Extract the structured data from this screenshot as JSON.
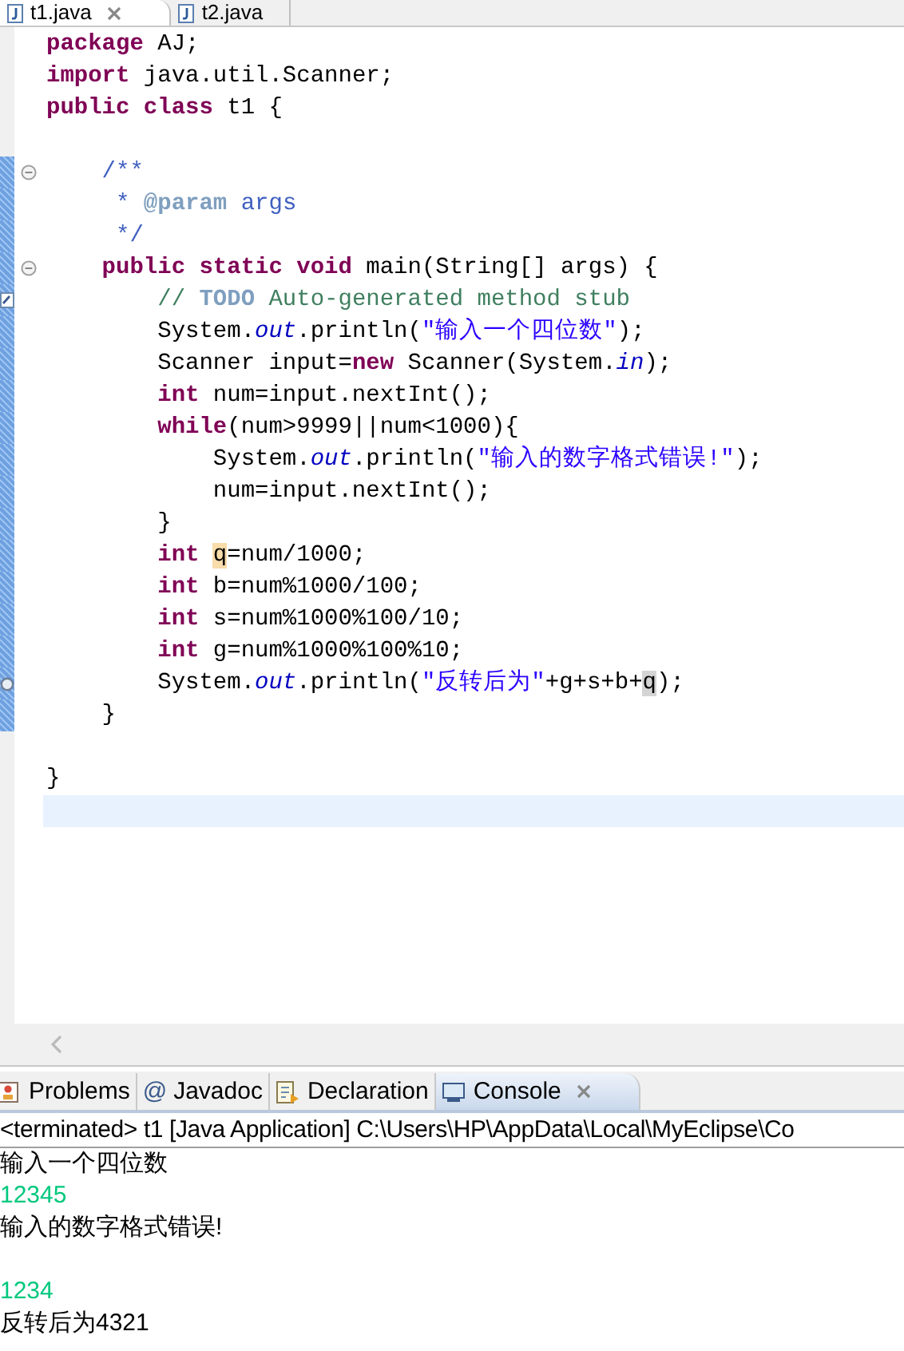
{
  "editor_tabs": [
    {
      "label": "t1.java",
      "selected": true,
      "closable": true
    },
    {
      "label": "t2.java",
      "selected": false,
      "closable": false
    }
  ],
  "code_lines": [
    {
      "kind": "plain",
      "current": false,
      "changed": false,
      "segments": [
        {
          "text": "package",
          "kind": "keyword"
        },
        {
          "text": " AJ;",
          "kind": "plain"
        }
      ]
    },
    {
      "kind": "plain",
      "current": false,
      "changed": false,
      "segments": [
        {
          "text": "import",
          "kind": "keyword"
        },
        {
          "text": " java.util.Scanner;",
          "kind": "plain"
        }
      ]
    },
    {
      "kind": "plain",
      "current": false,
      "changed": false,
      "segments": [
        {
          "text": "public",
          "kind": "keyword"
        },
        {
          "text": " class",
          "kind": "keyword"
        },
        {
          "text": " t1 {",
          "kind": "plain"
        }
      ]
    },
    {
      "kind": "plain",
      "current": false,
      "changed": false
    },
    {
      "kind": "fold",
      "current": false,
      "changed": true,
      "segments": [
        {
          "text": "    /**",
          "kind": "doc"
        }
      ]
    },
    {
      "kind": "plain",
      "current": false,
      "changed": true,
      "segments": [
        {
          "text": "     *",
          "kind": "doc"
        },
        {
          "text": " @param",
          "kind": "doctag"
        },
        {
          "text": " args",
          "kind": "doc"
        }
      ]
    },
    {
      "kind": "plain",
      "current": false,
      "changed": true,
      "segments": [
        {
          "text": "     */",
          "kind": "doc"
        }
      ]
    },
    {
      "kind": "fold",
      "current": false,
      "changed": true,
      "segments": [
        {
          "text": "    public",
          "kind": "keyword"
        },
        {
          "text": " static",
          "kind": "keyword"
        },
        {
          "text": " void",
          "kind": "keyword"
        },
        {
          "text": " main(String[] args) {",
          "kind": "plain"
        }
      ]
    },
    {
      "kind": "task",
      "current": false,
      "changed": true,
      "segments": [
        {
          "text": "        //",
          "kind": "comment"
        },
        {
          "text": " TODO",
          "kind": "todo"
        },
        {
          "text": " Auto-generated method stub",
          "kind": "comment"
        }
      ]
    },
    {
      "kind": "plain",
      "current": false,
      "changed": true,
      "segments": [
        {
          "text": "        System.",
          "kind": "plain"
        },
        {
          "text": "out",
          "kind": "field"
        },
        {
          "text": ".println(",
          "kind": "plain"
        },
        {
          "text": "\"输入一个四位数\"",
          "kind": "string"
        },
        {
          "text": ");",
          "kind": "plain"
        }
      ]
    },
    {
      "kind": "plain",
      "current": false,
      "changed": true,
      "segments": [
        {
          "text": "        Scanner input=",
          "kind": "plain"
        },
        {
          "text": "new",
          "kind": "keyword"
        },
        {
          "text": " Scanner(System.",
          "kind": "plain"
        },
        {
          "text": "in",
          "kind": "field"
        },
        {
          "text": ");",
          "kind": "plain"
        }
      ]
    },
    {
      "kind": "plain",
      "current": false,
      "changed": true,
      "segments": [
        {
          "text": "        int",
          "kind": "keyword"
        },
        {
          "text": " num=input.nextInt();",
          "kind": "plain"
        }
      ]
    },
    {
      "kind": "plain",
      "current": false,
      "changed": true,
      "segments": [
        {
          "text": "        while",
          "kind": "keyword"
        },
        {
          "text": "(num>9999||num<1000){",
          "kind": "plain"
        }
      ]
    },
    {
      "kind": "plain",
      "current": false,
      "changed": true,
      "segments": [
        {
          "text": "            System.",
          "kind": "plain"
        },
        {
          "text": "out",
          "kind": "field"
        },
        {
          "text": ".println(",
          "kind": "plain"
        },
        {
          "text": "\"输入的数字格式错误!\"",
          "kind": "string"
        },
        {
          "text": ");",
          "kind": "plain"
        }
      ]
    },
    {
      "kind": "plain",
      "current": false,
      "changed": true,
      "segments": [
        {
          "text": "            num=input.nextInt();",
          "kind": "plain"
        }
      ]
    },
    {
      "kind": "plain",
      "current": false,
      "changed": true,
      "segments": [
        {
          "text": "        }",
          "kind": "plain"
        }
      ]
    },
    {
      "kind": "plain",
      "current": false,
      "changed": true,
      "segments": [
        {
          "text": "        int ",
          "kind": "keyword"
        },
        {
          "text": "q",
          "kind": "occurrence"
        },
        {
          "text": "=num/1000;",
          "kind": "plain"
        }
      ]
    },
    {
      "kind": "plain",
      "current": false,
      "changed": true,
      "segments": [
        {
          "text": "        int",
          "kind": "keyword"
        },
        {
          "text": " b=num%1000/100;",
          "kind": "plain"
        }
      ]
    },
    {
      "kind": "plain",
      "current": false,
      "changed": true,
      "segments": [
        {
          "text": "        int",
          "kind": "keyword"
        },
        {
          "text": " s=num%1000%100/10;",
          "kind": "plain"
        }
      ]
    },
    {
      "kind": "plain",
      "current": false,
      "changed": true,
      "segments": [
        {
          "text": "        int",
          "kind": "keyword"
        },
        {
          "text": " g=num%1000%100%10;",
          "kind": "plain"
        }
      ]
    },
    {
      "kind": "ring",
      "current": false,
      "changed": true,
      "segments": [
        {
          "text": "        System.",
          "kind": "plain"
        },
        {
          "text": "out",
          "kind": "field"
        },
        {
          "text": ".println(",
          "kind": "plain"
        },
        {
          "text": "\"反转后为\"",
          "kind": "string"
        },
        {
          "text": "+g+s+b+",
          "kind": "plain"
        },
        {
          "text": "q",
          "kind": "caret"
        },
        {
          "text": ");",
          "kind": "plain"
        }
      ]
    },
    {
      "kind": "plain",
      "current": false,
      "changed": true,
      "segments": [
        {
          "text": "    }",
          "kind": "plain"
        }
      ]
    },
    {
      "kind": "plain",
      "current": false,
      "changed": false
    },
    {
      "kind": "plain",
      "current": false,
      "changed": false,
      "segments": [
        {
          "text": "}",
          "kind": "plain"
        }
      ]
    },
    {
      "kind": "plain",
      "current": true,
      "changed": false
    }
  ],
  "panel_tabs": [
    {
      "label": "Problems",
      "selected": false,
      "closable": false
    },
    {
      "label": "Javadoc",
      "glyph": "@",
      "selected": false,
      "closable": false
    },
    {
      "label": "Declaration",
      "selected": false,
      "closable": false
    },
    {
      "label": "Console",
      "selected": true,
      "closable": true
    }
  ],
  "console": {
    "header": "<terminated> t1 [Java Application] C:\\Users\\HP\\AppData\\Local\\MyEclipse\\Co",
    "lines": [
      {
        "kind": "output",
        "text": "输入一个四位数"
      },
      {
        "kind": "input",
        "text": "12345"
      },
      {
        "kind": "output",
        "text": "输入的数字格式错误!"
      },
      {
        "kind": "blank"
      },
      {
        "kind": "input",
        "text": "1234"
      },
      {
        "kind": "output",
        "text": "反转后为4321"
      }
    ]
  }
}
